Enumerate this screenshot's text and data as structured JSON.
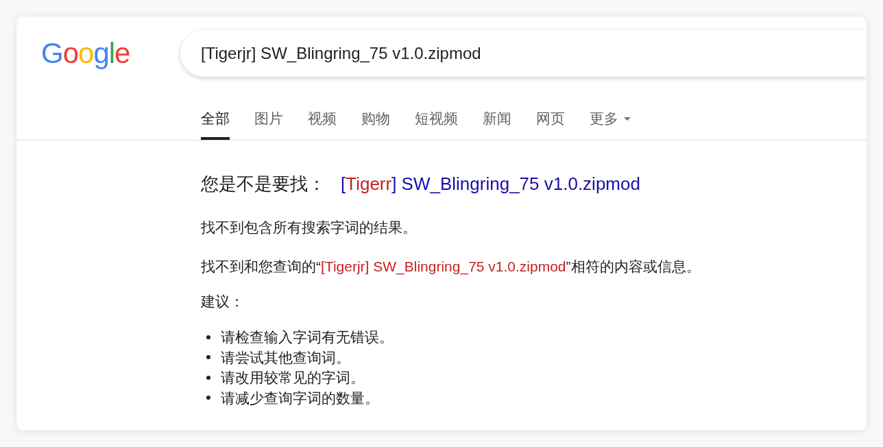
{
  "logo": {
    "text": "Google"
  },
  "search": {
    "value": "[Tigerjr] SW_Blingring_75 v1.0.zipmod"
  },
  "tabs": [
    {
      "label": "全部",
      "selected": true,
      "kind": "tab"
    },
    {
      "label": "图片",
      "selected": false,
      "kind": "tab"
    },
    {
      "label": "视频",
      "selected": false,
      "kind": "tab"
    },
    {
      "label": "购物",
      "selected": false,
      "kind": "tab"
    },
    {
      "label": "短视频",
      "selected": false,
      "kind": "tab"
    },
    {
      "label": "新闻",
      "selected": false,
      "kind": "tab"
    },
    {
      "label": "网页",
      "selected": false,
      "kind": "tab"
    },
    {
      "label": "更多",
      "selected": false,
      "kind": "dropdown"
    }
  ],
  "did_you_mean": {
    "label": "您是不是要找：",
    "suggestion": [
      {
        "text": "[",
        "corrected": false
      },
      {
        "text": "Tigerr",
        "corrected": true
      },
      {
        "text": "] SW_Blingring_75 v1.0.zipmod",
        "corrected": false
      }
    ]
  },
  "messages": [
    "找不到包含所有搜索字词的结果。"
  ],
  "no_match": {
    "prefix": "找不到和您查询的“",
    "query": "[Tigerjr] SW_Blingring_75 v1.0.zipmod",
    "suffix": "”相符的内容或信息。"
  },
  "suggestions": {
    "title": "建议：",
    "items": [
      "请检查输入字词有无错误。",
      "请尝试其他查询词。",
      "请改用较常见的字词。",
      "请减少查询字词的数量。"
    ]
  }
}
